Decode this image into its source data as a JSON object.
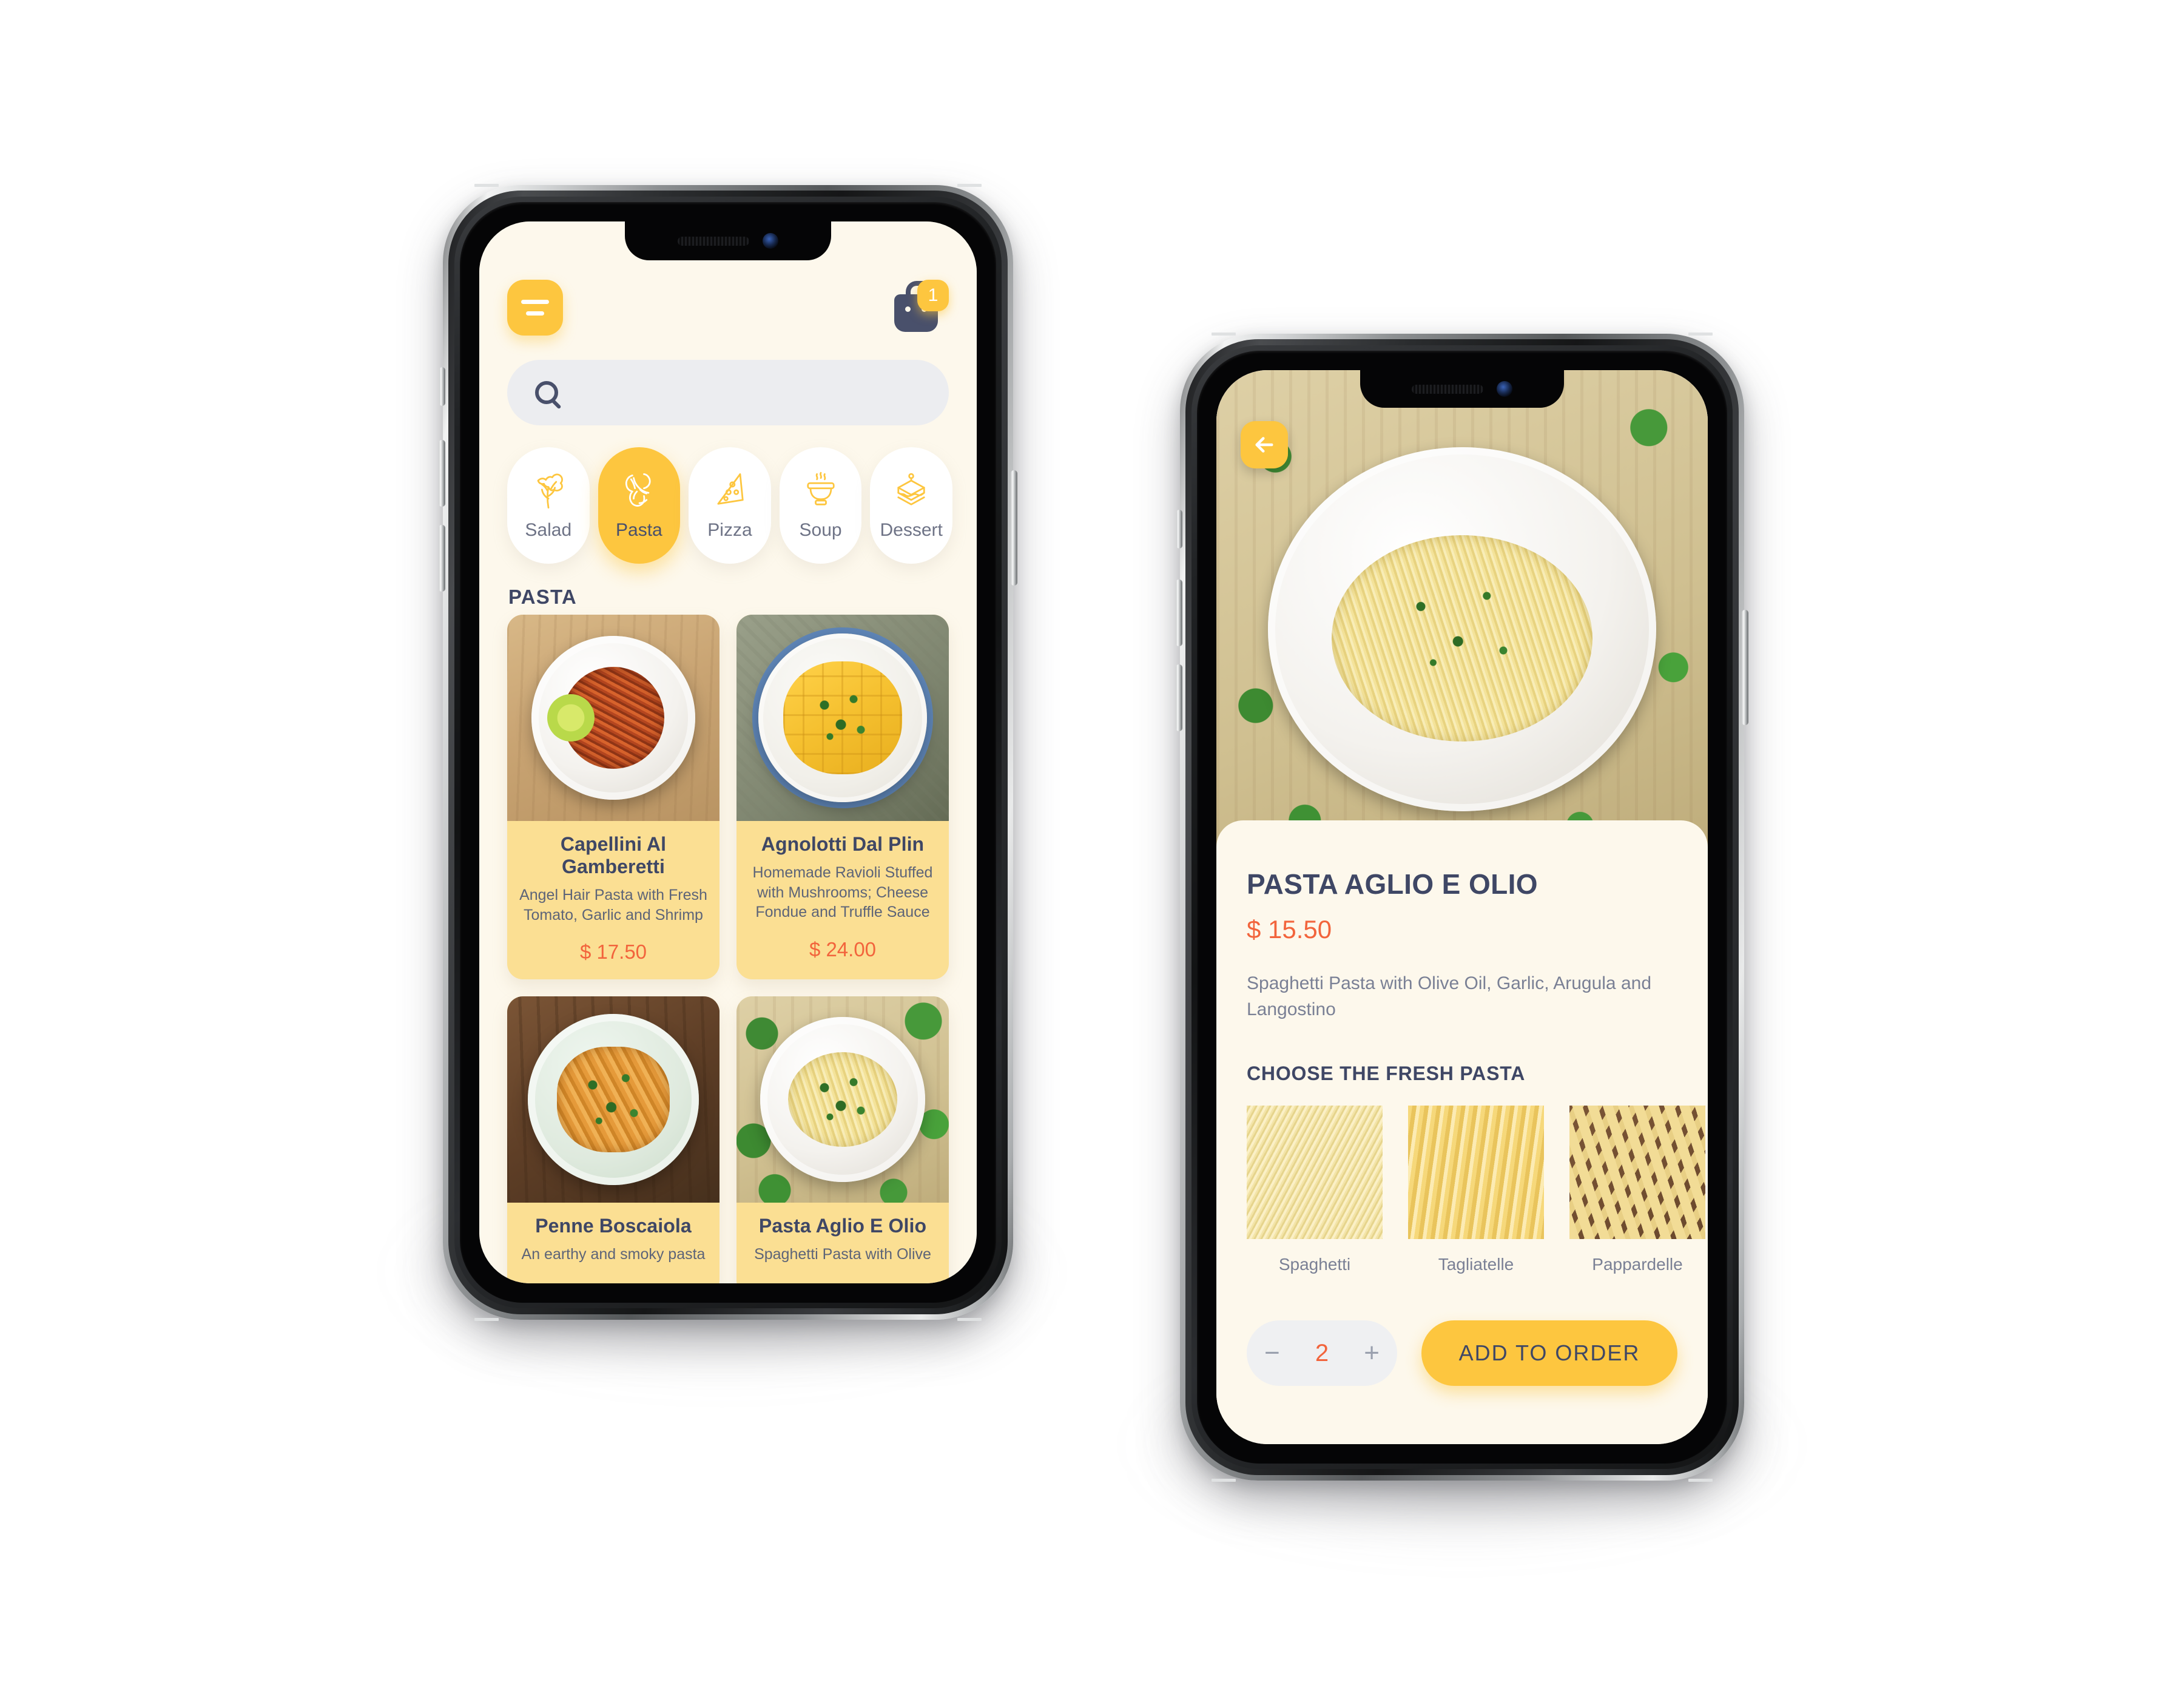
{
  "colors": {
    "accent_yellow": "#FDC63F",
    "card_yellow": "#FBDF93",
    "price_orange": "#F2643C",
    "navy_text": "#3F4765",
    "muted_text": "#7A8095",
    "screen_bg": "#FDF8EC",
    "field_grey": "#ECEDF0"
  },
  "menu_screen": {
    "menu_button_icon": "hamburger-icon",
    "cart": {
      "icon": "shopping-bag-icon",
      "badge_count": "1"
    },
    "search": {
      "icon": "search-icon",
      "placeholder": "",
      "value": ""
    },
    "categories": [
      {
        "label": "Salad",
        "icon": "lettuce-icon",
        "selected": false
      },
      {
        "label": "Pasta",
        "icon": "farfalle-icon",
        "selected": true
      },
      {
        "label": "Pizza",
        "icon": "pizza-slice-icon",
        "selected": false
      },
      {
        "label": "Soup",
        "icon": "soup-bowl-icon",
        "selected": false
      },
      {
        "label": "Dessert",
        "icon": "cake-slice-icon",
        "selected": false
      }
    ],
    "section_title": "PASTA",
    "dishes": [
      {
        "name": "Capellini Al Gamberetti",
        "description": "Angel Hair Pasta with Fresh Tomato, Garlic and Shrimp",
        "price": "$ 17.50"
      },
      {
        "name": "Agnolotti Dal Plin",
        "description": "Homemade Ravioli Stuffed with Mushrooms; Cheese Fondue and Truffle Sauce",
        "price": "$ 24.00"
      },
      {
        "name": "Penne Boscaiola",
        "description": "An earthy and smoky pasta",
        "price": ""
      },
      {
        "name": "Pasta Aglio E Olio",
        "description": "Spaghetti Pasta with Olive",
        "price": ""
      }
    ]
  },
  "detail_screen": {
    "back_icon": "arrow-left-icon",
    "title": "PASTA AGLIO E OLIO",
    "price": "$ 15.50",
    "description": "Spaghetti Pasta with Olive Oil, Garlic, Arugula and Langostino",
    "options_title": "CHOOSE THE FRESH PASTA",
    "options": [
      {
        "label": "Spaghetti"
      },
      {
        "label": "Tagliatelle"
      },
      {
        "label": "Pappardelle"
      }
    ],
    "stepper": {
      "minus": "−",
      "quantity": "2",
      "plus": "+"
    },
    "add_button_label": "ADD TO ORDER"
  }
}
